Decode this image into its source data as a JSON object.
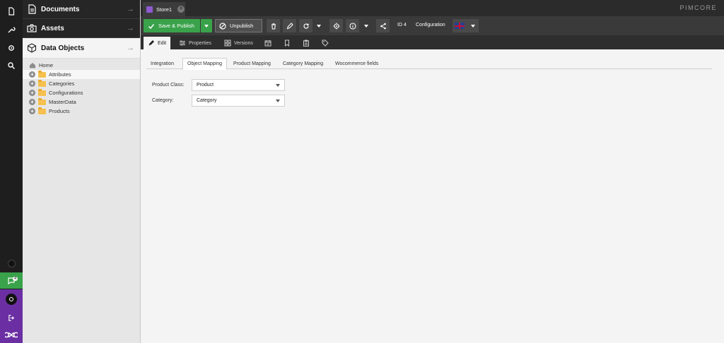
{
  "sidebar": {
    "sections": [
      {
        "label": "Documents",
        "icon": "document-icon"
      },
      {
        "label": "Assets",
        "icon": "camera-icon"
      },
      {
        "label": "Data Objects",
        "icon": "cube-icon"
      }
    ],
    "tree": {
      "root": "Home",
      "items": [
        "Attributes",
        "Categories",
        "Configurations",
        "MasterData",
        "Products"
      ]
    },
    "rail": {
      "notification_count": "4"
    }
  },
  "tabs": {
    "open_document": "Store1"
  },
  "brand": {
    "logo": "PIMCORE"
  },
  "toolbar": {
    "save_publish": "Save & Publish",
    "unpublish": "Unpublish",
    "id_label": "ID 4",
    "type_label": "Configuration",
    "language": "en"
  },
  "subtabs": {
    "edit": "Edit",
    "properties": "Properties",
    "versions": "Versions"
  },
  "content": {
    "tabs": [
      "Integration",
      "Object Mapping",
      "Product Mapping",
      "Category Mapping",
      "Wocommerce fields"
    ],
    "active_tab": "Object Mapping",
    "fields": {
      "product_class_label": "Product Class:",
      "product_class_value": "Product",
      "category_label": "Category:",
      "category_value": "Category"
    }
  },
  "colors": {
    "accent_green": "#39a24a",
    "rail_purple": "#6b2fa3",
    "dark": "#2b2b2b"
  }
}
